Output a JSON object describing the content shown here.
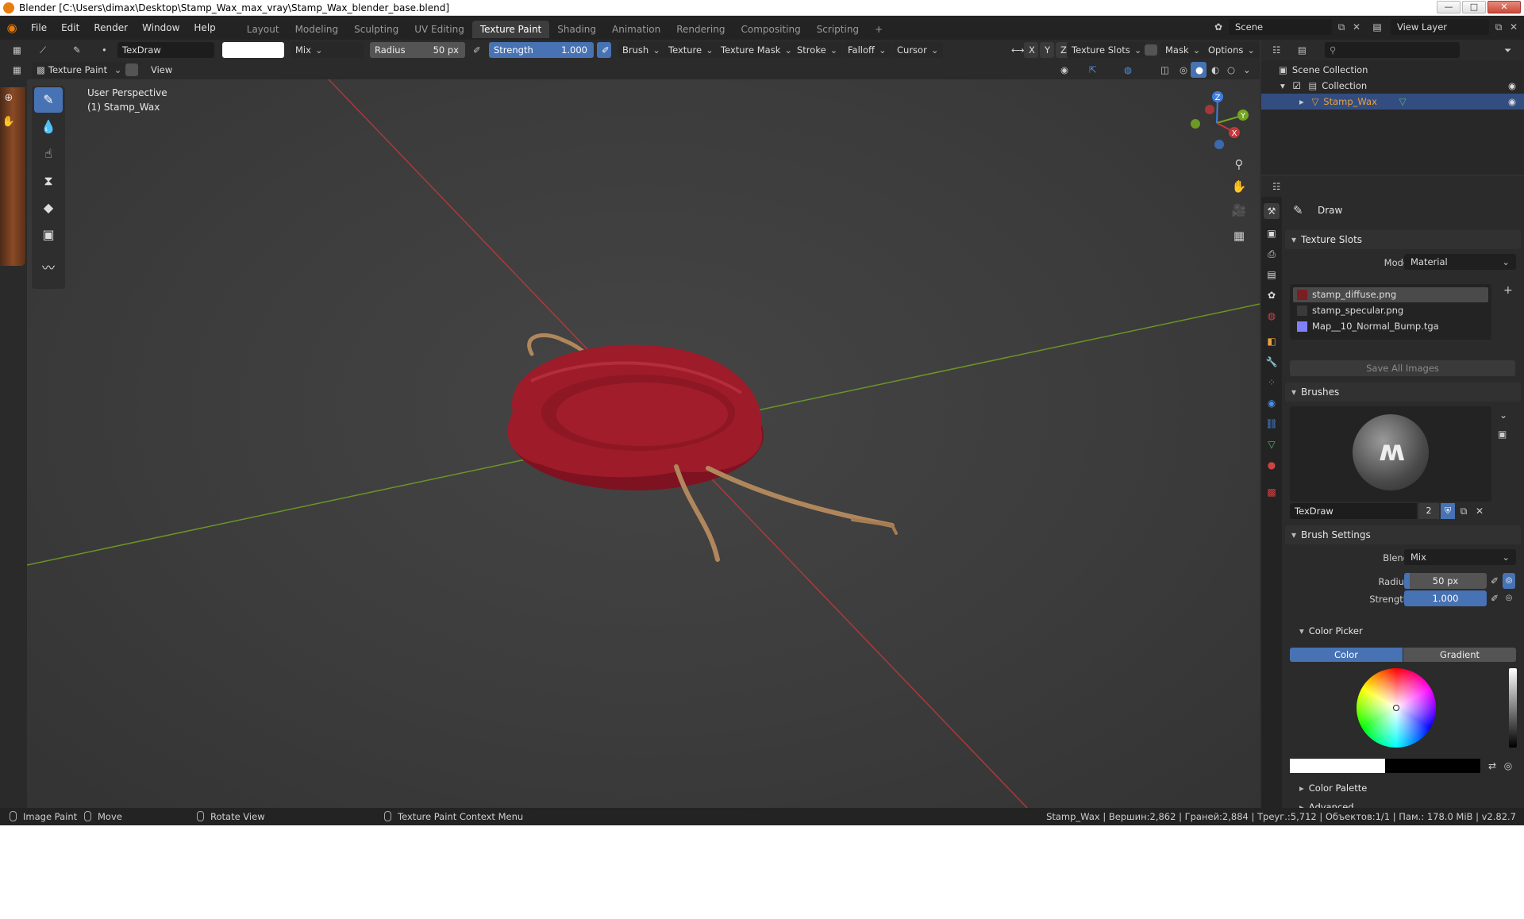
{
  "window": {
    "title": "Blender [C:\\Users\\dimax\\Desktop\\Stamp_Wax_max_vray\\Stamp_Wax_blender_base.blend]",
    "buttons": [
      "—",
      "□",
      "✕"
    ]
  },
  "menubar": {
    "menus": [
      "File",
      "Edit",
      "Render",
      "Window",
      "Help"
    ],
    "workspaces": [
      "Layout",
      "Modeling",
      "Sculpting",
      "UV Editing",
      "Texture Paint",
      "Shading",
      "Animation",
      "Rendering",
      "Compositing",
      "Scripting"
    ],
    "active_workspace": "Texture Paint",
    "add_tab": "+",
    "scene": "Scene",
    "view_layer": "View Layer"
  },
  "tool_header": {
    "brush_name": "TexDraw",
    "blend": "Mix",
    "radius_label": "Radius",
    "radius_value": "50 px",
    "strength_label": "Strength",
    "strength_value": "1.000",
    "menus": [
      "Brush",
      "Texture",
      "Texture Mask",
      "Stroke",
      "Falloff",
      "Cursor"
    ],
    "axes": [
      "X",
      "Y",
      "Z"
    ],
    "texture_slots": "Texture Slots",
    "mask": "Mask",
    "options": "Options"
  },
  "view_header": {
    "mode": "Texture Paint",
    "view": "View"
  },
  "viewport": {
    "perspective": "User Perspective",
    "object_label": "(1) Stamp_Wax",
    "gizmo_axes": [
      "X",
      "Y",
      "Z"
    ]
  },
  "outliner": {
    "rows": [
      "Scene Collection",
      "Collection",
      "Stamp_Wax"
    ]
  },
  "properties": {
    "tool_name": "Draw",
    "texture_slots": {
      "title": "Texture Slots",
      "mode_label": "Mode",
      "mode_value": "Material",
      "slots": [
        "stamp_diffuse.png",
        "stamp_specular.png",
        "Map__10_Normal_Bump.tga"
      ],
      "slot_colors": [
        "#7a1e22",
        "#3a3a3a",
        "#8080ff"
      ],
      "save_all": "Save All Images"
    },
    "brushes": {
      "title": "Brushes",
      "brush_name": "TexDraw",
      "users": "2"
    },
    "brush_settings": {
      "title": "Brush Settings",
      "blend_label": "Blend",
      "blend_value": "Mix",
      "radius_label": "Radius",
      "radius_value": "50 px",
      "strength_label": "Strength",
      "strength_value": "1.000"
    },
    "color_picker": {
      "title": "Color Picker",
      "tabs": [
        "Color",
        "Gradient"
      ],
      "active_tab": "Color",
      "primary_color": "#ffffff",
      "secondary_color": "#000000"
    },
    "color_palette": "Color Palette",
    "advanced": "Advanced"
  },
  "statusbar": {
    "items": [
      "Image Paint",
      "Move",
      "Rotate View",
      "Texture Paint Context Menu"
    ],
    "stats": "Stamp_Wax | Вершин:2,862 | Граней:2,884 | Треуг.:5,712 | Объектов:1/1 | Пам.: 178.0 MiB | v2.82.7"
  },
  "colors": {
    "accent": "#4772b3",
    "wax": "#9e1b2a",
    "rope": "#b0875c",
    "x_axis": "#c2383a",
    "y_axis": "#73a521",
    "z_axis": "#3f7fe0"
  }
}
